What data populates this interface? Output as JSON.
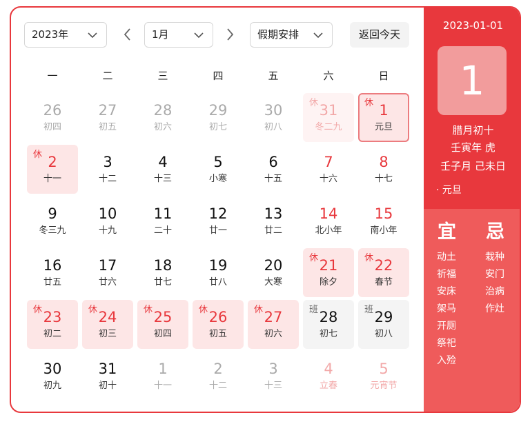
{
  "toolbar": {
    "year": "2023年",
    "month": "1月",
    "holiday_select": "假期安排",
    "today_button": "返回今天"
  },
  "weekdays": [
    "一",
    "二",
    "三",
    "四",
    "五",
    "六",
    "日"
  ],
  "days": [
    {
      "day": "26",
      "lunar": "初四",
      "state": "other"
    },
    {
      "day": "27",
      "lunar": "初五",
      "state": "other"
    },
    {
      "day": "28",
      "lunar": "初六",
      "state": "other"
    },
    {
      "day": "29",
      "lunar": "初七",
      "state": "other"
    },
    {
      "day": "30",
      "lunar": "初八",
      "state": "other"
    },
    {
      "day": "31",
      "lunar": "冬二九",
      "state": "other weekend holiday",
      "tag": "休"
    },
    {
      "day": "1",
      "lunar": "元旦",
      "state": "weekend holiday selected",
      "tag": "休"
    },
    {
      "day": "2",
      "lunar": "十一",
      "state": "holiday",
      "tag": "休"
    },
    {
      "day": "3",
      "lunar": "十二",
      "state": ""
    },
    {
      "day": "4",
      "lunar": "十三",
      "state": ""
    },
    {
      "day": "5",
      "lunar": "小寒",
      "state": ""
    },
    {
      "day": "6",
      "lunar": "十五",
      "state": ""
    },
    {
      "day": "7",
      "lunar": "十六",
      "state": "weekend"
    },
    {
      "day": "8",
      "lunar": "十七",
      "state": "weekend"
    },
    {
      "day": "9",
      "lunar": "冬三九",
      "state": ""
    },
    {
      "day": "10",
      "lunar": "十九",
      "state": ""
    },
    {
      "day": "11",
      "lunar": "二十",
      "state": ""
    },
    {
      "day": "12",
      "lunar": "廿一",
      "state": ""
    },
    {
      "day": "13",
      "lunar": "廿二",
      "state": ""
    },
    {
      "day": "14",
      "lunar": "北小年",
      "state": "weekend"
    },
    {
      "day": "15",
      "lunar": "南小年",
      "state": "weekend"
    },
    {
      "day": "16",
      "lunar": "廿五",
      "state": ""
    },
    {
      "day": "17",
      "lunar": "廿六",
      "state": ""
    },
    {
      "day": "18",
      "lunar": "廿七",
      "state": ""
    },
    {
      "day": "19",
      "lunar": "廿八",
      "state": ""
    },
    {
      "day": "20",
      "lunar": "大寒",
      "state": ""
    },
    {
      "day": "21",
      "lunar": "除夕",
      "state": "weekend holiday",
      "tag": "休"
    },
    {
      "day": "22",
      "lunar": "春节",
      "state": "weekend holiday",
      "tag": "休"
    },
    {
      "day": "23",
      "lunar": "初二",
      "state": "holiday",
      "tag": "休"
    },
    {
      "day": "24",
      "lunar": "初三",
      "state": "holiday",
      "tag": "休"
    },
    {
      "day": "25",
      "lunar": "初四",
      "state": "holiday",
      "tag": "休"
    },
    {
      "day": "26",
      "lunar": "初五",
      "state": "holiday",
      "tag": "休"
    },
    {
      "day": "27",
      "lunar": "初六",
      "state": "holiday",
      "tag": "休"
    },
    {
      "day": "28",
      "lunar": "初七",
      "state": "work",
      "tag": "班"
    },
    {
      "day": "29",
      "lunar": "初八",
      "state": "work",
      "tag": "班"
    },
    {
      "day": "30",
      "lunar": "初九",
      "state": ""
    },
    {
      "day": "31",
      "lunar": "初十",
      "state": ""
    },
    {
      "day": "1",
      "lunar": "十一",
      "state": "other"
    },
    {
      "day": "2",
      "lunar": "十二",
      "state": "other"
    },
    {
      "day": "3",
      "lunar": "十三",
      "state": "other"
    },
    {
      "day": "4",
      "lunar": "立春",
      "state": "other weekend"
    },
    {
      "day": "5",
      "lunar": "元宵节",
      "state": "other weekend"
    }
  ],
  "detail": {
    "date": "2023-01-01",
    "day": "1",
    "lunar_date": "腊月初十",
    "year_ganzhi": "壬寅年 虎",
    "month_day_ganzhi": "壬子月 己未日",
    "festival": "· 元旦",
    "yi_title": "宜",
    "ji_title": "忌",
    "yi": [
      "动土",
      "祈福",
      "安床",
      "架马",
      "开厕",
      "祭祀",
      "入殓"
    ],
    "ji": [
      "栽种",
      "安门",
      "治病",
      "作灶"
    ]
  },
  "colors": {
    "accent": "#e8383d",
    "panel_lower": "#ef5b5b",
    "holiday_bg": "#fde6e6"
  }
}
